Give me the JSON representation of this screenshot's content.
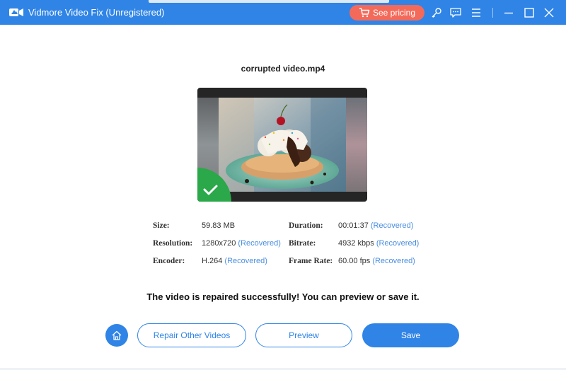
{
  "window": {
    "title": "Vidmore Video Fix (Unregistered)",
    "pricing_label": "See pricing",
    "icons": [
      "app-icon",
      "cart-icon",
      "key-icon",
      "feedback-icon",
      "menu-icon",
      "minimize-icon",
      "maximize-icon",
      "close-icon"
    ]
  },
  "video": {
    "file_name": "corrupted video.mp4"
  },
  "details": {
    "size": {
      "label": "Size:",
      "value": "59.83 MB"
    },
    "resolution": {
      "label": "Resolution:",
      "value": "1280x720",
      "status": "(Recovered)"
    },
    "encoder": {
      "label": "Encoder:",
      "value": "H.264",
      "status": "(Recovered)"
    },
    "duration": {
      "label": "Duration:",
      "value": "00:01:37",
      "status": "(Recovered)"
    },
    "bitrate": {
      "label": "Bitrate:",
      "value": "4932 kbps",
      "status": "(Recovered)"
    },
    "frame_rate": {
      "label": "Frame Rate:",
      "value": "60.00 fps",
      "status": "(Recovered)"
    }
  },
  "message": "The video is repaired successfully! You can preview or save it.",
  "actions": {
    "repair_other_label": "Repair Other Videos",
    "preview_label": "Preview",
    "save_label": "Save"
  },
  "colors": {
    "accent": "#2f84e6",
    "pricing": "#f46a5a",
    "recovered": "#4a8ee0",
    "success_badge": "#2aa84a"
  }
}
